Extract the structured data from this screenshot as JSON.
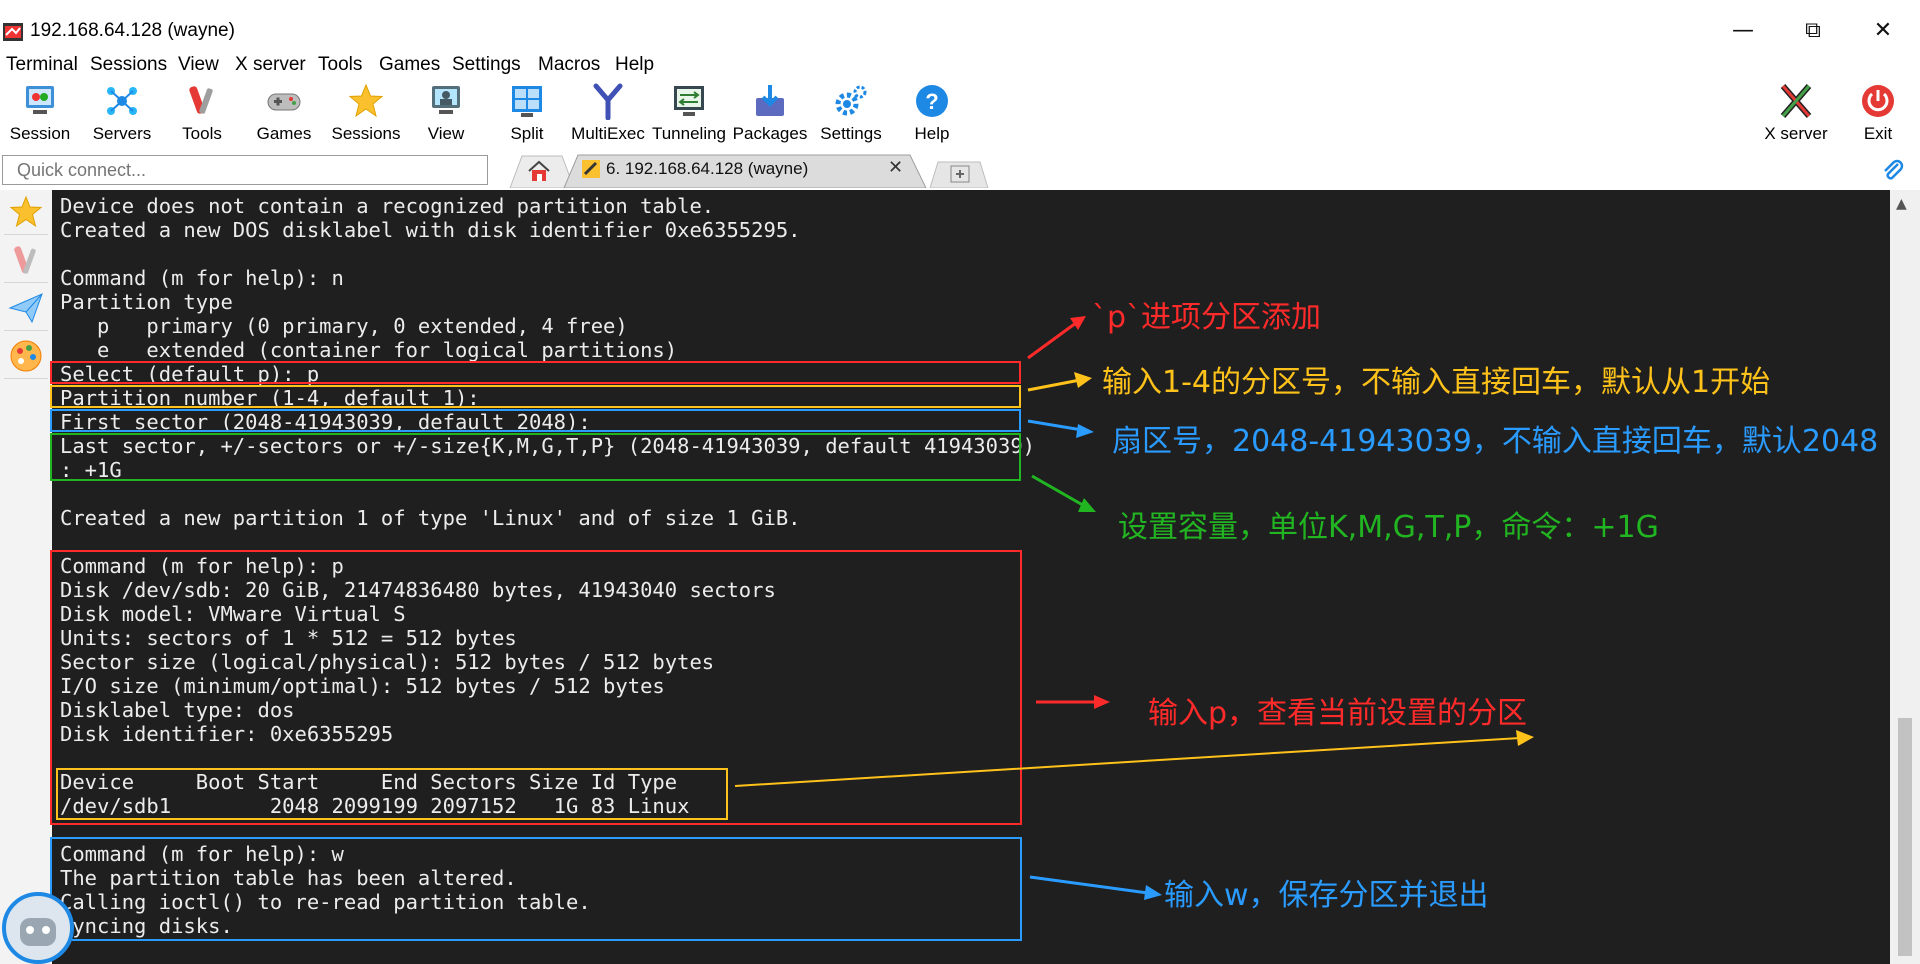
{
  "window": {
    "title": "192.168.64.128 (wayne)",
    "minimize": "—",
    "restore": "⧉",
    "close": "✕"
  },
  "menu": [
    "Terminal",
    "Sessions",
    "View",
    "X server",
    "Tools",
    "Games",
    "Settings",
    "Macros",
    "Help"
  ],
  "toolbar": {
    "session": "Session",
    "servers": "Servers",
    "tools": "Tools",
    "games": "Games",
    "sessions": "Sessions",
    "view": "View",
    "split": "Split",
    "multiexec": "MultiExec",
    "tunneling": "Tunneling",
    "packages": "Packages",
    "settings": "Settings",
    "help": "Help",
    "xserver": "X server",
    "exit": "Exit"
  },
  "quick_connect": {
    "placeholder": "Quick connect..."
  },
  "tab": {
    "label": "6. 192.168.64.128 (wayne)"
  },
  "terminal_lines": [
    "Device does not contain a recognized partition table.",
    "Created a new DOS disklabel with disk identifier 0xe6355295.",
    "",
    "Command (m for help): n",
    "Partition type",
    "   p   primary (0 primary, 0 extended, 4 free)",
    "   e   extended (container for logical partitions)",
    "Select (default p): p",
    "Partition number (1-4, default 1):",
    "First sector (2048-41943039, default 2048):",
    "Last sector, +/-sectors or +/-size{K,M,G,T,P} (2048-41943039, default 41943039)",
    ": +1G",
    "",
    "Created a new partition 1 of type 'Linux' and of size 1 GiB.",
    "",
    "Command (m for help): p",
    "Disk /dev/sdb: 20 GiB, 21474836480 bytes, 41943040 sectors",
    "Disk model: VMware Virtual S",
    "Units: sectors of 1 * 512 = 512 bytes",
    "Sector size (logical/physical): 512 bytes / 512 bytes",
    "I/O size (minimum/optimal): 512 bytes / 512 bytes",
    "Disklabel type: dos",
    "Disk identifier: 0xe6355295",
    "",
    "Device     Boot Start     End Sectors Size Id Type",
    "/dev/sdb1        2048 2099199 2097152   1G 83 Linux",
    "",
    "Command (m for help): w",
    "The partition table has been altered.",
    "Calling ioctl() to re-read partition table.",
    "Syncing disks."
  ],
  "annotations": {
    "a1": "`p`进项分区添加",
    "a2": "输入1-4的分区号，不输入直接回车，默认从1开始",
    "a3": "扇区号，2048-41943039，不输入直接回车，默认2048",
    "a4": "设置容量，单位K,M,G,T,P，命令：+1G",
    "a5": "输入p，查看当前设置的分区",
    "a6": "输入w，保存分区并退出"
  },
  "colors": {
    "red": "#ff2a2a",
    "yellow": "#ffc21a",
    "blue": "#2a9bff",
    "green": "#22b522",
    "terminal_bg": "#1f1f1f",
    "terminal_fg": "#ececec"
  }
}
